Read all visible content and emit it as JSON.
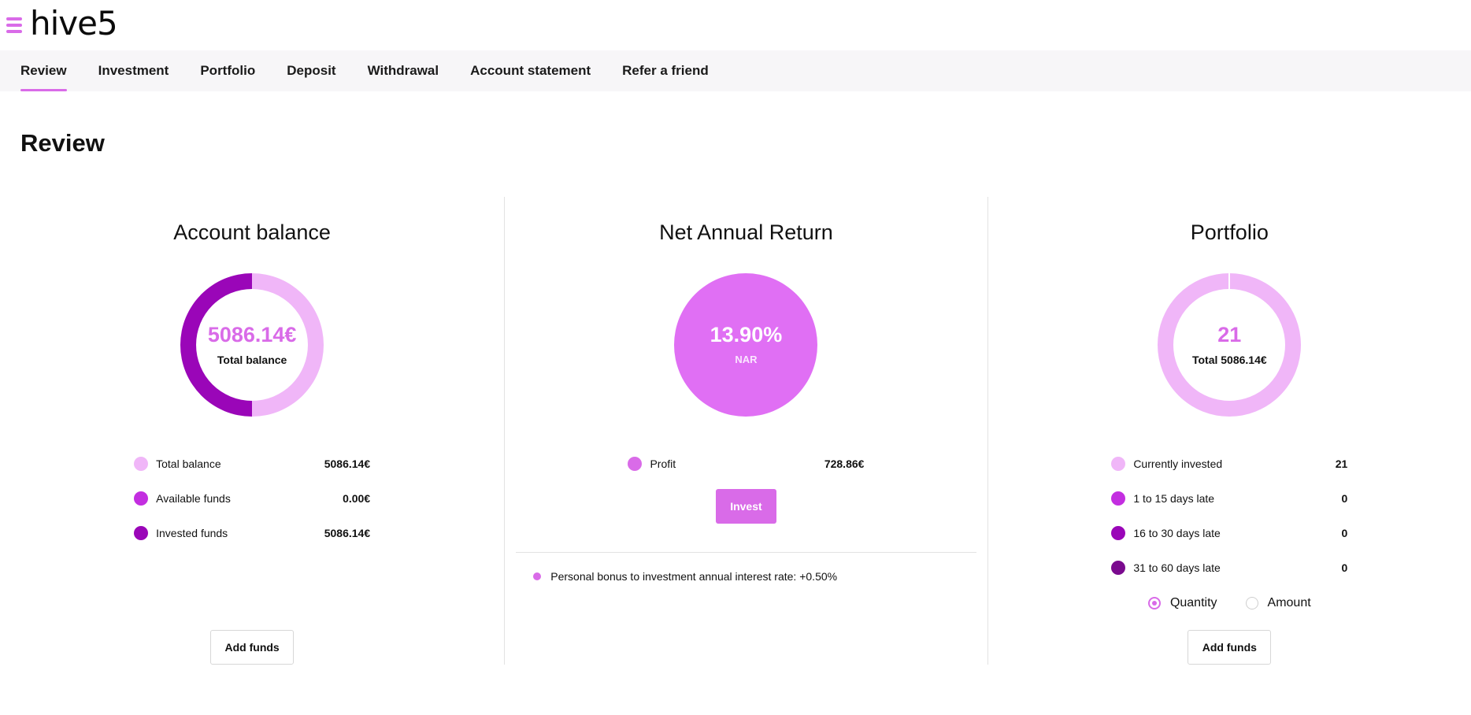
{
  "app": {
    "logo": "hive5"
  },
  "nav": {
    "items": [
      {
        "label": "Review",
        "active": true
      },
      {
        "label": "Investment"
      },
      {
        "label": "Portfolio"
      },
      {
        "label": "Deposit"
      },
      {
        "label": "Withdrawal"
      },
      {
        "label": "Account statement"
      },
      {
        "label": "Refer a friend"
      }
    ]
  },
  "page": {
    "title": "Review"
  },
  "colors": {
    "accent": "#d96be8",
    "light": "#f0b6f8",
    "mid": "#c32ee0",
    "dark": "#9a06b8",
    "darkest": "#7a0a8e"
  },
  "account_balance": {
    "title": "Account balance",
    "center_value": "5086.14€",
    "center_label": "Total balance",
    "ring": {
      "light_fraction": 0.5,
      "dark_fraction": 0.5
    },
    "legend": [
      {
        "label": "Total balance",
        "value": "5086.14€",
        "color": "#f0b6f8"
      },
      {
        "label": "Available funds",
        "value": "0.00€",
        "color": "#c32ee0"
      },
      {
        "label": "Invested funds",
        "value": "5086.14€",
        "color": "#9a06b8"
      }
    ],
    "button": "Add funds"
  },
  "net_annual_return": {
    "title": "Net Annual Return",
    "center_value": "13.90%",
    "center_label": "NAR",
    "legend": [
      {
        "label": "Profit",
        "value": "728.86€",
        "color": "#d96be8"
      }
    ],
    "button": "Invest",
    "bonus_text": "Personal bonus to investment annual interest rate: +0.50%"
  },
  "portfolio": {
    "title": "Portfolio",
    "center_value": "21",
    "center_label": "Total 5086.14€",
    "legend": [
      {
        "label": "Currently invested",
        "value": "21",
        "color": "#f0b6f8"
      },
      {
        "label": "1 to 15 days late",
        "value": "0",
        "color": "#c32ee0"
      },
      {
        "label": "16 to 30 days late",
        "value": "0",
        "color": "#9a06b8"
      },
      {
        "label": "31 to 60 days late",
        "value": "0",
        "color": "#7a0a8e"
      }
    ],
    "radio_options": [
      {
        "label": "Quantity",
        "checked": true
      },
      {
        "label": "Amount",
        "checked": false
      }
    ],
    "button": "Add funds"
  }
}
